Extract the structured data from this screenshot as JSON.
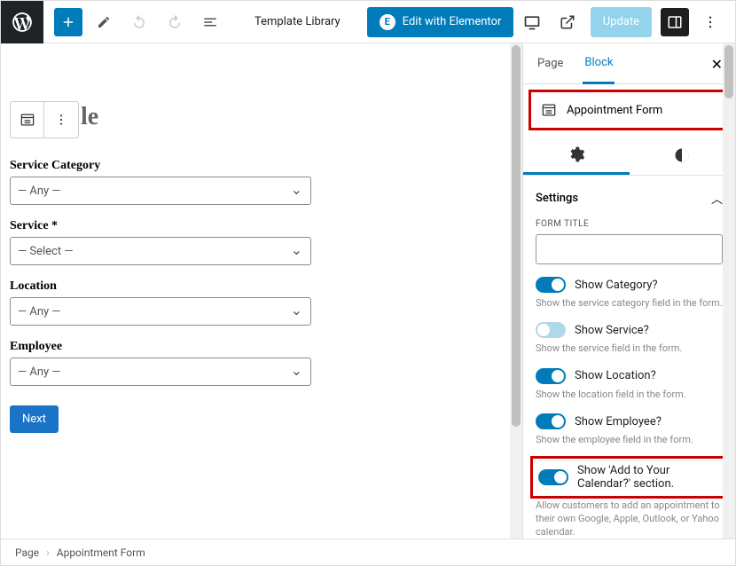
{
  "topbar": {
    "template_library": "Template Library",
    "edit_elementor": "Edit with Elementor",
    "update": "Update"
  },
  "title_fragment": "le",
  "form": {
    "category_label": "Service Category",
    "category_value": "— Any —",
    "service_label": "Service *",
    "service_value": "— Select —",
    "location_label": "Location",
    "location_value": "— Any —",
    "employee_label": "Employee",
    "employee_value": "— Any —",
    "next": "Next"
  },
  "sidebar": {
    "tabs": {
      "page": "Page",
      "block": "Block"
    },
    "block_name": "Appointment Form",
    "section_settings": "Settings",
    "form_title_label": "FORM TITLE",
    "toggles": {
      "category": {
        "label": "Show Category?",
        "desc": "Show the service category field in the form."
      },
      "service": {
        "label": "Show Service?",
        "desc": "Show the service field in the form."
      },
      "location": {
        "label": "Show Location?",
        "desc": "Show the location field in the form."
      },
      "employee": {
        "label": "Show Employee?",
        "desc": "Show the employee field in the form."
      },
      "calendar": {
        "label": "Show 'Add to Your Calendar?' section.",
        "desc": "Allow customers to add an appointment to their own Google, Apple, Outlook, or Yahoo calendar."
      }
    }
  },
  "breadcrumb": {
    "root": "Page",
    "current": "Appointment Form"
  }
}
